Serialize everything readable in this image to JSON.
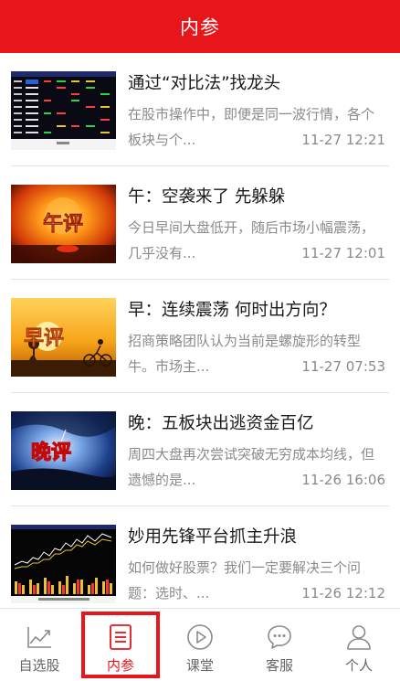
{
  "header": {
    "title": "内参"
  },
  "articles": [
    {
      "title": "通过“对比法”找龙头",
      "summary": "在股市操作中，即便是同一波行情，各个板块与个...",
      "time": "11-27 12:21",
      "thumb_icon": "stock-table-thumbnail"
    },
    {
      "title": "午：空袭来了 先躲躲",
      "summary": "今日早间大盘低开，随后市场小幅震荡，几乎没有...",
      "time": "11-27 12:01",
      "thumb_icon": "noon-review-thumbnail",
      "thumb_text": "午评"
    },
    {
      "title": "早：连续震荡 何时出方向？",
      "summary": "招商策略团队认为当前是螺旋形的转型牛。市场主...",
      "time": "11-27 07:53",
      "thumb_icon": "morning-review-thumbnail",
      "thumb_text": "早评"
    },
    {
      "title": "晚：五板块出逃资金百亿",
      "summary": "周四大盘再次尝试突破无穷成本均线，但遗憾的是...",
      "time": "11-26 16:06",
      "thumb_icon": "evening-review-thumbnail",
      "thumb_text": "晚评"
    },
    {
      "title": "妙用先锋平台抓主升浪",
      "summary": "如何做好股票？我们一定要解决三个问题：选时、...",
      "time": "11-26 12:12",
      "thumb_icon": "stock-chart-thumbnail"
    }
  ],
  "tabs": [
    {
      "label": "自选股",
      "icon": "trend-chart-icon"
    },
    {
      "label": "内参",
      "icon": "document-list-icon",
      "active": true
    },
    {
      "label": "课堂",
      "icon": "play-circle-icon"
    },
    {
      "label": "客服",
      "icon": "chat-bubble-icon"
    },
    {
      "label": "个人",
      "icon": "person-icon"
    }
  ],
  "colors": {
    "brand_red": "#e8151b",
    "text_gray": "#8a8a8a",
    "tab_gray": "#666666"
  }
}
